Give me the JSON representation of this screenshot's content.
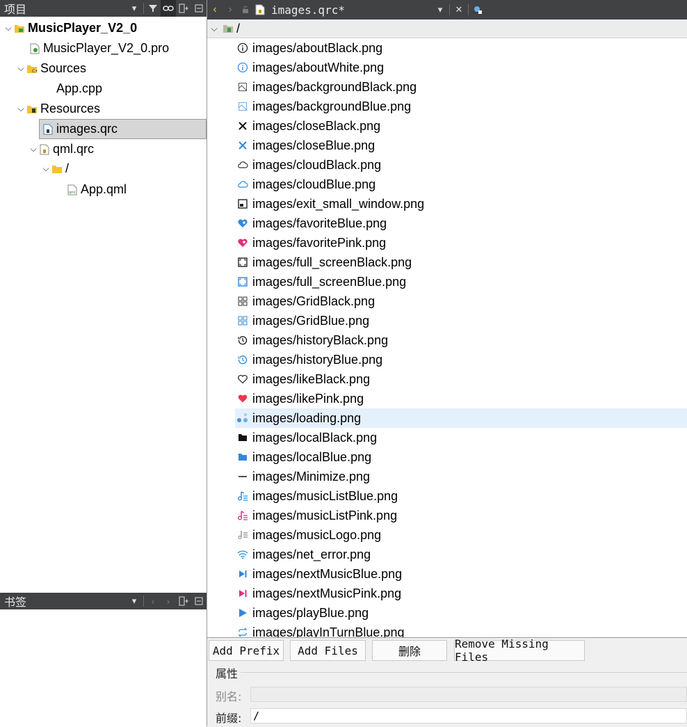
{
  "projects_panel": {
    "title": "项目"
  },
  "tree": {
    "project": "MusicPlayer_V2_0",
    "pro_file": "MusicPlayer_V2_0.pro",
    "sources": "Sources",
    "app_cpp": "App.cpp",
    "resources": "Resources",
    "images_qrc": "images.qrc",
    "qml_qrc": "qml.qrc",
    "slash": "/",
    "app_qml": "App.qml"
  },
  "bookmarks_panel": {
    "title": "书签"
  },
  "editor": {
    "doc_title": "images.qrc*",
    "root_prefix": "/",
    "files": [
      {
        "name": "images/aboutBlack.png",
        "icon": "info-icon",
        "color": "#222222"
      },
      {
        "name": "images/aboutWhite.png",
        "icon": "info-icon",
        "color": "#3a8ee6"
      },
      {
        "name": "images/backgroundBlack.png",
        "icon": "background-icon",
        "color": "#555555"
      },
      {
        "name": "images/backgroundBlue.png",
        "icon": "background-icon",
        "color": "#6aaee8"
      },
      {
        "name": "images/closeBlack.png",
        "icon": "close-icon",
        "color": "#111111"
      },
      {
        "name": "images/closeBlue.png",
        "icon": "close-icon",
        "color": "#2f8ad8"
      },
      {
        "name": "images/cloudBlack.png",
        "icon": "cloud-icon",
        "color": "#333333"
      },
      {
        "name": "images/cloudBlue.png",
        "icon": "cloud-icon",
        "color": "#2f8ad8"
      },
      {
        "name": "images/exit_small_window.png",
        "icon": "exit-window-icon",
        "color": "#222222"
      },
      {
        "name": "images/favoriteBlue.png",
        "icon": "favorite-icon",
        "color": "#2f8ad8"
      },
      {
        "name": "images/favoritePink.png",
        "icon": "favorite-icon",
        "color": "#e0307a"
      },
      {
        "name": "images/full_screenBlack.png",
        "icon": "fullscreen-icon",
        "color": "#222222"
      },
      {
        "name": "images/full_screenBlue.png",
        "icon": "fullscreen-icon",
        "color": "#2f8ad8"
      },
      {
        "name": "images/GridBlack.png",
        "icon": "grid-icon",
        "color": "#333333"
      },
      {
        "name": "images/GridBlue.png",
        "icon": "grid-icon",
        "color": "#2f8ad8"
      },
      {
        "name": "images/historyBlack.png",
        "icon": "history-icon",
        "color": "#222222"
      },
      {
        "name": "images/historyBlue.png",
        "icon": "history-icon",
        "color": "#2f8ad8"
      },
      {
        "name": "images/likeBlack.png",
        "icon": "heart-outline-icon",
        "color": "#333333"
      },
      {
        "name": "images/likePink.png",
        "icon": "heart-icon",
        "color": "#e8384f"
      },
      {
        "name": "images/loading.png",
        "icon": "loading-icon",
        "color": "#6aaee8"
      },
      {
        "name": "images/localBlack.png",
        "icon": "folder-icon",
        "color": "#111111"
      },
      {
        "name": "images/localBlue.png",
        "icon": "folder-icon",
        "color": "#2f8ad8"
      },
      {
        "name": "images/Minimize.png",
        "icon": "minimize-icon",
        "color": "#222222"
      },
      {
        "name": "images/musicListBlue.png",
        "icon": "music-list-icon",
        "color": "#2f8ad8"
      },
      {
        "name": "images/musicListPink.png",
        "icon": "music-list-icon",
        "color": "#e0307a"
      },
      {
        "name": "images/musicLogo.png",
        "icon": "music-logo-icon",
        "color": "#888888"
      },
      {
        "name": "images/net_error.png",
        "icon": "wifi-icon",
        "color": "#2f8ad8"
      },
      {
        "name": "images/nextMusicBlue.png",
        "icon": "next-icon",
        "color": "#2f8ad8"
      },
      {
        "name": "images/nextMusicPink.png",
        "icon": "next-icon",
        "color": "#e0307a"
      },
      {
        "name": "images/playBlue.png",
        "icon": "play-icon",
        "color": "#2f8ad8"
      },
      {
        "name": "images/playInTurnBlue.png",
        "icon": "repeat-icon",
        "color": "#2f8ad8"
      }
    ],
    "highlighted_index": 19
  },
  "buttons": {
    "add_prefix": "Add Prefix",
    "add_files": "Add Files",
    "remove": "删除",
    "remove_missing": "Remove Missing Files"
  },
  "properties": {
    "title": "属性",
    "alias_label": "别名:",
    "alias_value": "",
    "prefix_label": "前缀:",
    "prefix_value": "/"
  },
  "colors": {
    "panel_header": "#404244",
    "selection": "#d6d6d6",
    "highlight_row": "#e4f0fb",
    "accent_yellow": "#f2c230"
  }
}
